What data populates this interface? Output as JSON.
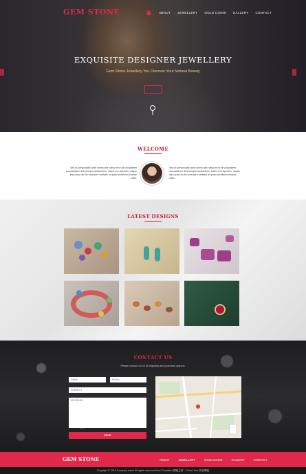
{
  "colors": {
    "accent": "#e0294a",
    "heading_red": "#c8203f",
    "footer_bg": "#e0294a"
  },
  "header": {
    "brand": "GEM STONE",
    "home_icon": "home-icon",
    "nav": [
      "ABOUT",
      "JEWELLERY",
      "GOLD COINS",
      "GALLERY",
      "CONTACT"
    ]
  },
  "hero": {
    "title": "EXQUISITE DESIGNER JEWELLERY",
    "subtitle": "Gem Stone Jewellery You Discover Your Natural Beauty",
    "pin_icon": "pin-icon"
  },
  "welcome": {
    "title": "WELCOME",
    "left_text": "Sed ut perspiciatis unde omnis iste natus error sit voluptatem accusantium doloremque laudantium, totam rem aperiam, eaque ipsa quae ab illo inventore veritatis et quasi architecto beatae vitae.",
    "right_text": "Sed ut perspiciatis unde omnis iste natus error sit voluptatem accusantium doloremque laudantium, totam rem aperiam, eaque ipsa quae ab illo inventore veritatis et quasi architecto beatae vitae."
  },
  "designs": {
    "title": "LATEST DESIGNS",
    "items": [
      "beaded-necklace",
      "drop-earrings",
      "purple-stone-necklace",
      "beaded-bracelet",
      "rings-display",
      "ruby-pendant"
    ]
  },
  "contact": {
    "title": "CONTACT US",
    "subtitle": "Please contact us for all inquiries and purchase options.",
    "name_placeholder": "NAME",
    "email_placeholder": "EMAIL",
    "subject_placeholder": "SUBJECT",
    "message_placeholder": "MESSAGE",
    "send_label": "SEND"
  },
  "footer": {
    "brand": "GEM STONE",
    "nav": [
      "ABOUT",
      "JEWELLERY",
      "GOLD COINS",
      "GALLERY",
      "CONTACT"
    ],
    "copyright": "Copyright © 2016 Company name All rights reserved.More Templates 模板之家 - Collect from 网页模板"
  }
}
